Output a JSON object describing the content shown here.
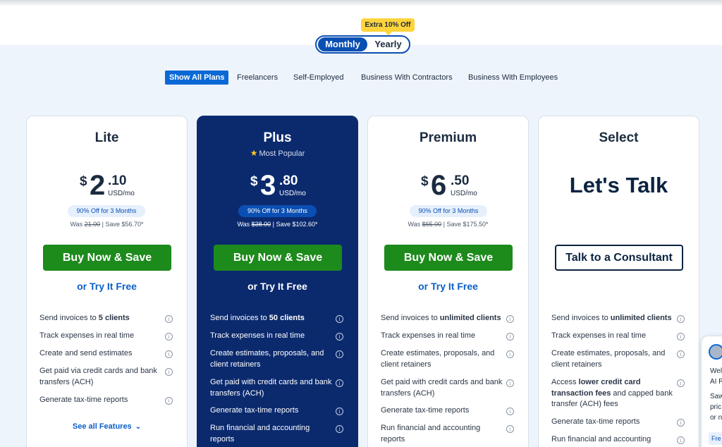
{
  "toggle": {
    "badge": "Extra 10% Off",
    "monthly": "Monthly",
    "yearly": "Yearly"
  },
  "filters": [
    "Show All Plans",
    "Freelancers",
    "Self-Employed",
    "Business With Contractors",
    "Business With Employees"
  ],
  "plans": [
    {
      "name": "Lite",
      "currency": "$",
      "whole": "2",
      "cents": ".10",
      "unit": "USD/mo",
      "discount": "90% Off for 3 Months",
      "was_prefix": "Was ",
      "was_price": "21.00",
      "save": " | Save $56.70*",
      "buy": "Buy Now & Save",
      "try": "or Try It Free",
      "features": [
        {
          "pre": "Send invoices to ",
          "bold": "5 clients",
          "post": ""
        },
        {
          "pre": "Track expenses in real time",
          "bold": "",
          "post": ""
        },
        {
          "pre": "Create and send estimates",
          "bold": "",
          "post": ""
        },
        {
          "pre": "Get paid via credit cards and bank transfers (ACH)",
          "bold": "",
          "post": ""
        },
        {
          "pre": "Generate tax-time reports",
          "bold": "",
          "post": ""
        }
      ],
      "see_all": "See all Features"
    },
    {
      "name": "Plus",
      "popular": "Most Popular",
      "currency": "$",
      "whole": "3",
      "cents": ".80",
      "unit": "USD/mo",
      "discount": "90% Off for 3 Months",
      "was_prefix": "Was ",
      "was_price": "$38.00",
      "save": " | Save $102.60*",
      "buy": "Buy Now & Save",
      "try": "or Try It Free",
      "features": [
        {
          "pre": "Send invoices to ",
          "bold": "50 clients",
          "post": ""
        },
        {
          "pre": "Track expenses in real time",
          "bold": "",
          "post": ""
        },
        {
          "pre": "Create estimates, proposals, and client retainers",
          "bold": "",
          "post": ""
        },
        {
          "pre": "Get paid with credit cards and bank transfers (ACH)",
          "bold": "",
          "post": ""
        },
        {
          "pre": "Generate tax-time reports",
          "bold": "",
          "post": ""
        },
        {
          "pre": "Run financial and accounting reports",
          "bold": "",
          "post": ""
        }
      ]
    },
    {
      "name": "Premium",
      "currency": "$",
      "whole": "6",
      "cents": ".50",
      "unit": "USD/mo",
      "discount": "90% Off for 3 Months",
      "was_prefix": "Was ",
      "was_price": "$65.00",
      "save": " | Save $175.50*",
      "buy": "Buy Now & Save",
      "try": "or Try It Free",
      "features": [
        {
          "pre": "Send invoices to ",
          "bold": "unlimited clients",
          "post": ""
        },
        {
          "pre": "Track expenses in real time",
          "bold": "",
          "post": ""
        },
        {
          "pre": "Create estimates, proposals, and client retainers",
          "bold": "",
          "post": ""
        },
        {
          "pre": "Get paid with credit cards and bank transfers (ACH)",
          "bold": "",
          "post": ""
        },
        {
          "pre": "Generate tax-time reports",
          "bold": "",
          "post": ""
        },
        {
          "pre": "Run financial and accounting reports",
          "bold": "",
          "post": ""
        }
      ]
    },
    {
      "name": "Select",
      "talk": "Let's Talk",
      "consult": "Talk to a Consultant",
      "features": [
        {
          "pre": "Send invoices to ",
          "bold": "unlimited clients",
          "post": ""
        },
        {
          "pre": "Track expenses in real time",
          "bold": "",
          "post": ""
        },
        {
          "pre": "Create estimates, proposals, and client retainers",
          "bold": "",
          "post": ""
        },
        {
          "pre": "Access ",
          "bold": "lower credit card transaction fees",
          "post": " and capped bank transfer (ACH) fees"
        },
        {
          "pre": "Generate tax-time reports",
          "bold": "",
          "post": ""
        },
        {
          "pre": "Run financial and accounting",
          "bold": "",
          "post": ""
        }
      ]
    }
  ],
  "chat": {
    "lines": [
      "Welc",
      "AI R",
      "Saw",
      "pric",
      "or n"
    ],
    "chip": "Fre"
  },
  "info_glyph": "i",
  "chevron_glyph": "⌄",
  "star_glyph": "★",
  "colors": {
    "primary": "#0a4fb3",
    "featured_bg": "#0b2a6e",
    "buy_green": "#1d8a1c",
    "badge_yellow": "#ffd43b"
  }
}
